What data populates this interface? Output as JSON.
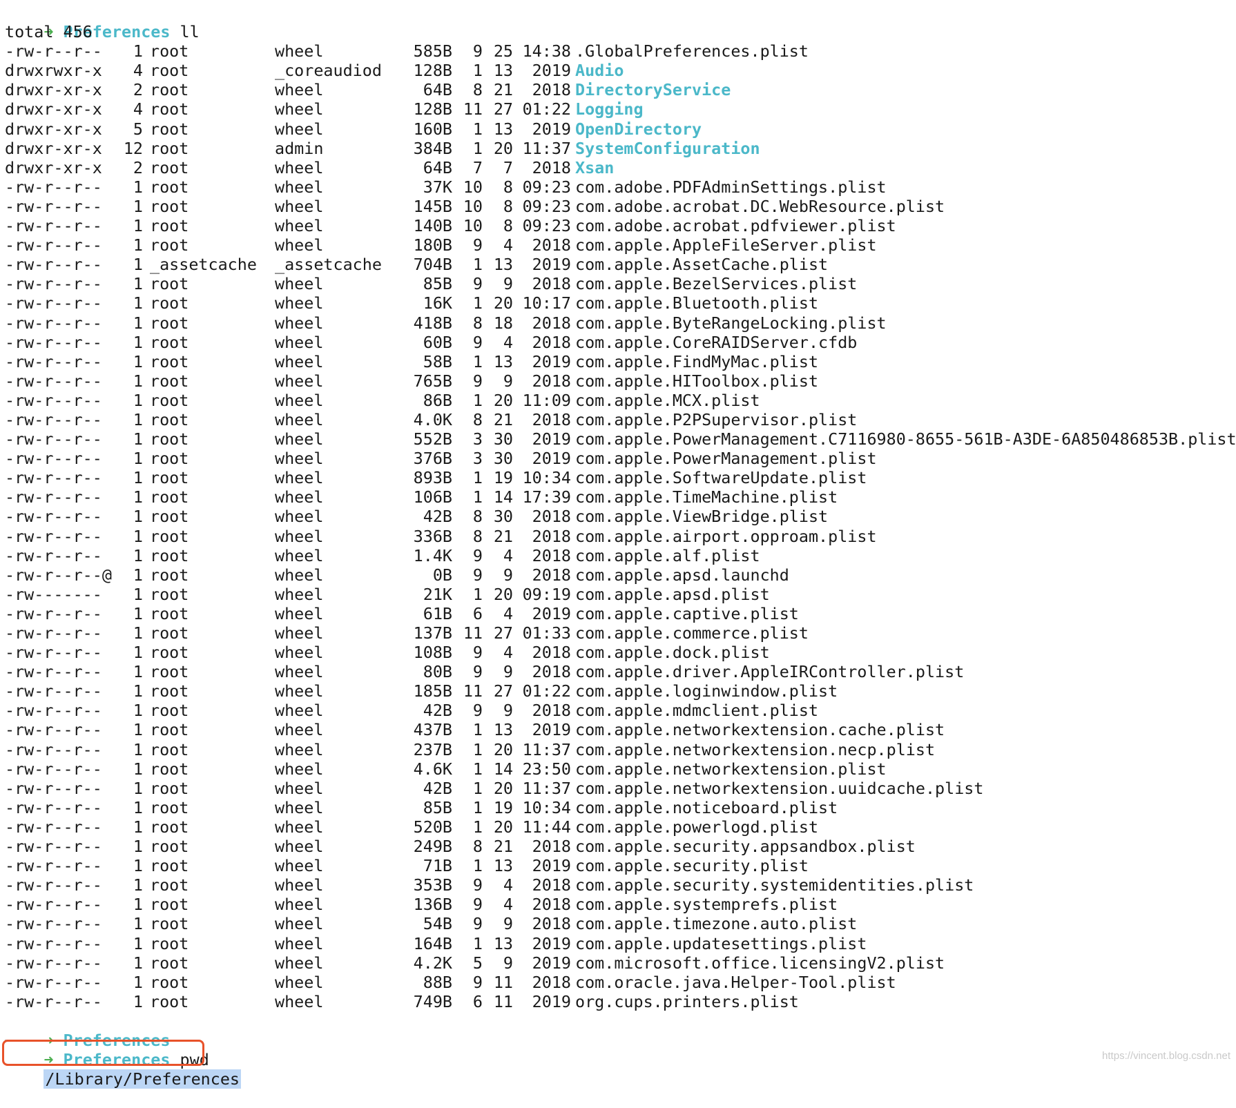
{
  "colors": {
    "prompt_arrow": "#4caf50",
    "prompt_dir": "#4bb8c9",
    "directory_name": "#4bb8c9",
    "highlight_border": "#e8522a",
    "selection_bg": "#bcd6f5"
  },
  "prompt1": {
    "arrow": "➜",
    "dir": "Preferences",
    "command": "ll"
  },
  "total": "total 456",
  "listing": [
    {
      "perm": "-rw-r--r--",
      "links": "1",
      "owner": "root",
      "group": "wheel",
      "size": "585B",
      "mon": "9",
      "day": "25",
      "time": "14:38",
      "name": ".GlobalPreferences.plist",
      "dir": false
    },
    {
      "perm": "drwxrwxr-x",
      "links": "4",
      "owner": "root",
      "group": "_coreaudiod",
      "size": "128B",
      "mon": "1",
      "day": "13",
      "time": "2019",
      "name": "Audio",
      "dir": true
    },
    {
      "perm": "drwxr-xr-x",
      "links": "2",
      "owner": "root",
      "group": "wheel",
      "size": "64B",
      "mon": "8",
      "day": "21",
      "time": "2018",
      "name": "DirectoryService",
      "dir": true
    },
    {
      "perm": "drwxr-xr-x",
      "links": "4",
      "owner": "root",
      "group": "wheel",
      "size": "128B",
      "mon": "11",
      "day": "27",
      "time": "01:22",
      "name": "Logging",
      "dir": true
    },
    {
      "perm": "drwxr-xr-x",
      "links": "5",
      "owner": "root",
      "group": "wheel",
      "size": "160B",
      "mon": "1",
      "day": "13",
      "time": "2019",
      "name": "OpenDirectory",
      "dir": true
    },
    {
      "perm": "drwxr-xr-x",
      "links": "12",
      "owner": "root",
      "group": "admin",
      "size": "384B",
      "mon": "1",
      "day": "20",
      "time": "11:37",
      "name": "SystemConfiguration",
      "dir": true
    },
    {
      "perm": "drwxr-xr-x",
      "links": "2",
      "owner": "root",
      "group": "wheel",
      "size": "64B",
      "mon": "7",
      "day": "7",
      "time": "2018",
      "name": "Xsan",
      "dir": true
    },
    {
      "perm": "-rw-r--r--",
      "links": "1",
      "owner": "root",
      "group": "wheel",
      "size": "37K",
      "mon": "10",
      "day": "8",
      "time": "09:23",
      "name": "com.adobe.PDFAdminSettings.plist",
      "dir": false
    },
    {
      "perm": "-rw-r--r--",
      "links": "1",
      "owner": "root",
      "group": "wheel",
      "size": "145B",
      "mon": "10",
      "day": "8",
      "time": "09:23",
      "name": "com.adobe.acrobat.DC.WebResource.plist",
      "dir": false
    },
    {
      "perm": "-rw-r--r--",
      "links": "1",
      "owner": "root",
      "group": "wheel",
      "size": "140B",
      "mon": "10",
      "day": "8",
      "time": "09:23",
      "name": "com.adobe.acrobat.pdfviewer.plist",
      "dir": false
    },
    {
      "perm": "-rw-r--r--",
      "links": "1",
      "owner": "root",
      "group": "wheel",
      "size": "180B",
      "mon": "9",
      "day": "4",
      "time": "2018",
      "name": "com.apple.AppleFileServer.plist",
      "dir": false
    },
    {
      "perm": "-rw-r--r--",
      "links": "1",
      "owner": "_assetcache",
      "group": "_assetcache",
      "size": "704B",
      "mon": "1",
      "day": "13",
      "time": "2019",
      "name": "com.apple.AssetCache.plist",
      "dir": false
    },
    {
      "perm": "-rw-r--r--",
      "links": "1",
      "owner": "root",
      "group": "wheel",
      "size": "85B",
      "mon": "9",
      "day": "9",
      "time": "2018",
      "name": "com.apple.BezelServices.plist",
      "dir": false
    },
    {
      "perm": "-rw-r--r--",
      "links": "1",
      "owner": "root",
      "group": "wheel",
      "size": "16K",
      "mon": "1",
      "day": "20",
      "time": "10:17",
      "name": "com.apple.Bluetooth.plist",
      "dir": false
    },
    {
      "perm": "-rw-r--r--",
      "links": "1",
      "owner": "root",
      "group": "wheel",
      "size": "418B",
      "mon": "8",
      "day": "18",
      "time": "2018",
      "name": "com.apple.ByteRangeLocking.plist",
      "dir": false
    },
    {
      "perm": "-rw-r--r--",
      "links": "1",
      "owner": "root",
      "group": "wheel",
      "size": "60B",
      "mon": "9",
      "day": "4",
      "time": "2018",
      "name": "com.apple.CoreRAIDServer.cfdb",
      "dir": false
    },
    {
      "perm": "-rw-r--r--",
      "links": "1",
      "owner": "root",
      "group": "wheel",
      "size": "58B",
      "mon": "1",
      "day": "13",
      "time": "2019",
      "name": "com.apple.FindMyMac.plist",
      "dir": false
    },
    {
      "perm": "-rw-r--r--",
      "links": "1",
      "owner": "root",
      "group": "wheel",
      "size": "765B",
      "mon": "9",
      "day": "9",
      "time": "2018",
      "name": "com.apple.HIToolbox.plist",
      "dir": false
    },
    {
      "perm": "-rw-r--r--",
      "links": "1",
      "owner": "root",
      "group": "wheel",
      "size": "86B",
      "mon": "1",
      "day": "20",
      "time": "11:09",
      "name": "com.apple.MCX.plist",
      "dir": false
    },
    {
      "perm": "-rw-r--r--",
      "links": "1",
      "owner": "root",
      "group": "wheel",
      "size": "4.0K",
      "mon": "8",
      "day": "21",
      "time": "2018",
      "name": "com.apple.P2PSupervisor.plist",
      "dir": false
    },
    {
      "perm": "-rw-r--r--",
      "links": "1",
      "owner": "root",
      "group": "wheel",
      "size": "552B",
      "mon": "3",
      "day": "30",
      "time": "2019",
      "name": "com.apple.PowerManagement.C7116980-8655-561B-A3DE-6A850486853B.plist",
      "dir": false
    },
    {
      "perm": "-rw-r--r--",
      "links": "1",
      "owner": "root",
      "group": "wheel",
      "size": "376B",
      "mon": "3",
      "day": "30",
      "time": "2019",
      "name": "com.apple.PowerManagement.plist",
      "dir": false
    },
    {
      "perm": "-rw-r--r--",
      "links": "1",
      "owner": "root",
      "group": "wheel",
      "size": "893B",
      "mon": "1",
      "day": "19",
      "time": "10:34",
      "name": "com.apple.SoftwareUpdate.plist",
      "dir": false
    },
    {
      "perm": "-rw-r--r--",
      "links": "1",
      "owner": "root",
      "group": "wheel",
      "size": "106B",
      "mon": "1",
      "day": "14",
      "time": "17:39",
      "name": "com.apple.TimeMachine.plist",
      "dir": false
    },
    {
      "perm": "-rw-r--r--",
      "links": "1",
      "owner": "root",
      "group": "wheel",
      "size": "42B",
      "mon": "8",
      "day": "30",
      "time": "2018",
      "name": "com.apple.ViewBridge.plist",
      "dir": false
    },
    {
      "perm": "-rw-r--r--",
      "links": "1",
      "owner": "root",
      "group": "wheel",
      "size": "336B",
      "mon": "8",
      "day": "21",
      "time": "2018",
      "name": "com.apple.airport.opproam.plist",
      "dir": false
    },
    {
      "perm": "-rw-r--r--",
      "links": "1",
      "owner": "root",
      "group": "wheel",
      "size": "1.4K",
      "mon": "9",
      "day": "4",
      "time": "2018",
      "name": "com.apple.alf.plist",
      "dir": false
    },
    {
      "perm": "-rw-r--r--@",
      "links": "1",
      "owner": "root",
      "group": "wheel",
      "size": "0B",
      "mon": "9",
      "day": "9",
      "time": "2018",
      "name": "com.apple.apsd.launchd",
      "dir": false
    },
    {
      "perm": "-rw-------",
      "links": "1",
      "owner": "root",
      "group": "wheel",
      "size": "21K",
      "mon": "1",
      "day": "20",
      "time": "09:19",
      "name": "com.apple.apsd.plist",
      "dir": false
    },
    {
      "perm": "-rw-r--r--",
      "links": "1",
      "owner": "root",
      "group": "wheel",
      "size": "61B",
      "mon": "6",
      "day": "4",
      "time": "2019",
      "name": "com.apple.captive.plist",
      "dir": false
    },
    {
      "perm": "-rw-r--r--",
      "links": "1",
      "owner": "root",
      "group": "wheel",
      "size": "137B",
      "mon": "11",
      "day": "27",
      "time": "01:33",
      "name": "com.apple.commerce.plist",
      "dir": false
    },
    {
      "perm": "-rw-r--r--",
      "links": "1",
      "owner": "root",
      "group": "wheel",
      "size": "108B",
      "mon": "9",
      "day": "4",
      "time": "2018",
      "name": "com.apple.dock.plist",
      "dir": false
    },
    {
      "perm": "-rw-r--r--",
      "links": "1",
      "owner": "root",
      "group": "wheel",
      "size": "80B",
      "mon": "9",
      "day": "9",
      "time": "2018",
      "name": "com.apple.driver.AppleIRController.plist",
      "dir": false
    },
    {
      "perm": "-rw-r--r--",
      "links": "1",
      "owner": "root",
      "group": "wheel",
      "size": "185B",
      "mon": "11",
      "day": "27",
      "time": "01:22",
      "name": "com.apple.loginwindow.plist",
      "dir": false
    },
    {
      "perm": "-rw-r--r--",
      "links": "1",
      "owner": "root",
      "group": "wheel",
      "size": "42B",
      "mon": "9",
      "day": "9",
      "time": "2018",
      "name": "com.apple.mdmclient.plist",
      "dir": false
    },
    {
      "perm": "-rw-r--r--",
      "links": "1",
      "owner": "root",
      "group": "wheel",
      "size": "437B",
      "mon": "1",
      "day": "13",
      "time": "2019",
      "name": "com.apple.networkextension.cache.plist",
      "dir": false
    },
    {
      "perm": "-rw-r--r--",
      "links": "1",
      "owner": "root",
      "group": "wheel",
      "size": "237B",
      "mon": "1",
      "day": "20",
      "time": "11:37",
      "name": "com.apple.networkextension.necp.plist",
      "dir": false
    },
    {
      "perm": "-rw-r--r--",
      "links": "1",
      "owner": "root",
      "group": "wheel",
      "size": "4.6K",
      "mon": "1",
      "day": "14",
      "time": "23:50",
      "name": "com.apple.networkextension.plist",
      "dir": false
    },
    {
      "perm": "-rw-r--r--",
      "links": "1",
      "owner": "root",
      "group": "wheel",
      "size": "42B",
      "mon": "1",
      "day": "20",
      "time": "11:37",
      "name": "com.apple.networkextension.uuidcache.plist",
      "dir": false
    },
    {
      "perm": "-rw-r--r--",
      "links": "1",
      "owner": "root",
      "group": "wheel",
      "size": "85B",
      "mon": "1",
      "day": "19",
      "time": "10:34",
      "name": "com.apple.noticeboard.plist",
      "dir": false
    },
    {
      "perm": "-rw-r--r--",
      "links": "1",
      "owner": "root",
      "group": "wheel",
      "size": "520B",
      "mon": "1",
      "day": "20",
      "time": "11:44",
      "name": "com.apple.powerlogd.plist",
      "dir": false
    },
    {
      "perm": "-rw-r--r--",
      "links": "1",
      "owner": "root",
      "group": "wheel",
      "size": "249B",
      "mon": "8",
      "day": "21",
      "time": "2018",
      "name": "com.apple.security.appsandbox.plist",
      "dir": false
    },
    {
      "perm": "-rw-r--r--",
      "links": "1",
      "owner": "root",
      "group": "wheel",
      "size": "71B",
      "mon": "1",
      "day": "13",
      "time": "2019",
      "name": "com.apple.security.plist",
      "dir": false
    },
    {
      "perm": "-rw-r--r--",
      "links": "1",
      "owner": "root",
      "group": "wheel",
      "size": "353B",
      "mon": "9",
      "day": "4",
      "time": "2018",
      "name": "com.apple.security.systemidentities.plist",
      "dir": false
    },
    {
      "perm": "-rw-r--r--",
      "links": "1",
      "owner": "root",
      "group": "wheel",
      "size": "136B",
      "mon": "9",
      "day": "4",
      "time": "2018",
      "name": "com.apple.systemprefs.plist",
      "dir": false
    },
    {
      "perm": "-rw-r--r--",
      "links": "1",
      "owner": "root",
      "group": "wheel",
      "size": "54B",
      "mon": "9",
      "day": "9",
      "time": "2018",
      "name": "com.apple.timezone.auto.plist",
      "dir": false
    },
    {
      "perm": "-rw-r--r--",
      "links": "1",
      "owner": "root",
      "group": "wheel",
      "size": "164B",
      "mon": "1",
      "day": "13",
      "time": "2019",
      "name": "com.apple.updatesettings.plist",
      "dir": false
    },
    {
      "perm": "-rw-r--r--",
      "links": "1",
      "owner": "root",
      "group": "wheel",
      "size": "4.2K",
      "mon": "5",
      "day": "9",
      "time": "2019",
      "name": "com.microsoft.office.licensingV2.plist",
      "dir": false
    },
    {
      "perm": "-rw-r--r--",
      "links": "1",
      "owner": "root",
      "group": "wheel",
      "size": "88B",
      "mon": "9",
      "day": "11",
      "time": "2018",
      "name": "com.oracle.java.Helper-Tool.plist",
      "dir": false
    },
    {
      "perm": "-rw-r--r--",
      "links": "1",
      "owner": "root",
      "group": "wheel",
      "size": "749B",
      "mon": "6",
      "day": "11",
      "time": "2019",
      "name": "org.cups.printers.plist",
      "dir": false
    }
  ],
  "prompt2": {
    "arrow": "➜",
    "dir": "Preferences"
  },
  "prompt3": {
    "arrow": "➜",
    "dir": "Preferences",
    "command": "pwd"
  },
  "pwd_output": "/Library/Preferences",
  "watermark": "https://vincent.blog.csdn.net"
}
